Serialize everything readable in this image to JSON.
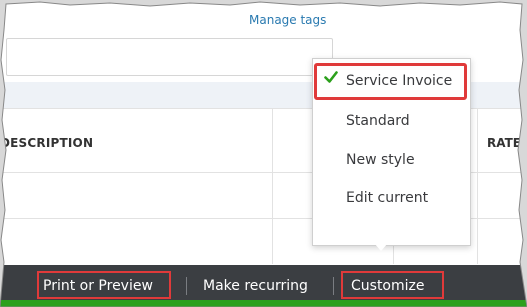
{
  "header": {
    "manage_tags_link": "Manage tags"
  },
  "table": {
    "columns": {
      "description": "DESCRIPTION",
      "rate": "RATE"
    }
  },
  "customize_menu": {
    "items": [
      {
        "label": "Service Invoice",
        "selected": true
      },
      {
        "label": "Standard",
        "selected": false
      },
      {
        "label": "New style",
        "selected": false
      },
      {
        "label": "Edit current",
        "selected": false
      }
    ]
  },
  "toolbar": {
    "print_preview_label": "Print or Preview",
    "make_recurring_label": "Make recurring",
    "customize_label": "Customize"
  },
  "colors": {
    "toolbar_bg": "#3b3e42",
    "highlight_border": "#e03a3a",
    "check_green": "#2ca01c",
    "link_blue": "#2a7ab0"
  },
  "icons": {
    "selected_check": "checkmark-icon",
    "menu_pointer": "caret-down-icon"
  }
}
